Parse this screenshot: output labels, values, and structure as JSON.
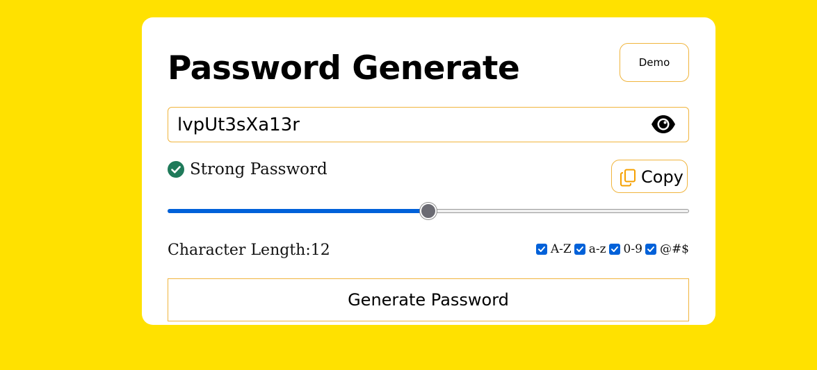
{
  "app": {
    "title": "Password Generate",
    "demo_button_label": "Demo"
  },
  "password": {
    "value": "lvpUt3sXa13r"
  },
  "strength": {
    "label": "Strong Password",
    "color": "#1f7a5a"
  },
  "copy_button": {
    "label": "Copy",
    "icon": "copy-icon"
  },
  "length": {
    "label": "Character Length:",
    "value": "12",
    "slider_fraction": 0.5
  },
  "options": [
    {
      "label": "A-Z",
      "checked": true
    },
    {
      "label": "a-z",
      "checked": true
    },
    {
      "label": "0-9",
      "checked": true
    },
    {
      "label": "@#$",
      "checked": true
    }
  ],
  "generate_button": {
    "label": "Generate Password"
  },
  "colors": {
    "background": "#FFE100",
    "accent_border": "#f0b43c",
    "slider_fill": "#0061d9"
  }
}
